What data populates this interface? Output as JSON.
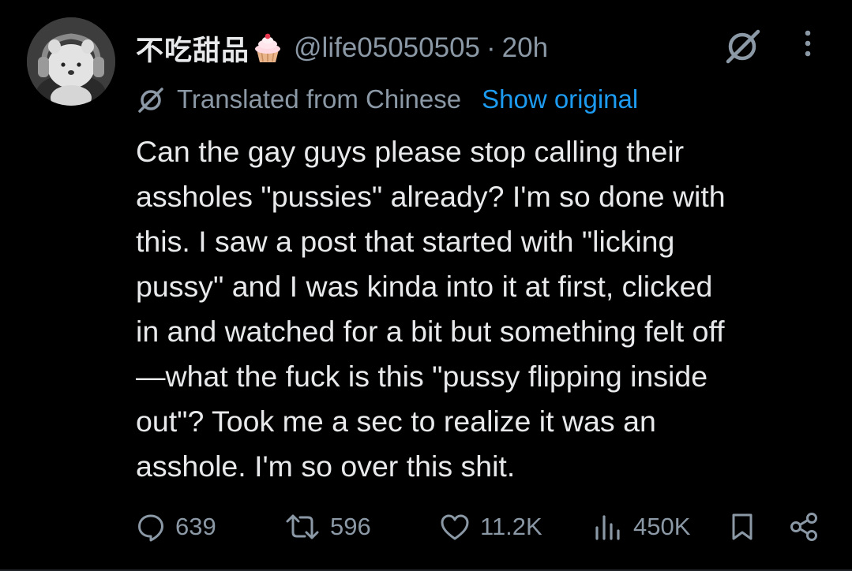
{
  "tweet": {
    "author": {
      "display_name": "不吃甜品",
      "name_emoji": "cupcake-emoji",
      "handle": "@life05050505",
      "separator": "·",
      "time": "20h"
    },
    "translation": {
      "label": "Translated from Chinese",
      "show_original": "Show original"
    },
    "text": "Can the gay guys please stop calling their\nassholes \"pussies\" already? I'm so done with\nthis. I saw a post that started with \"licking\npussy\" and I was kinda into it at first, clicked\nin and watched for a bit but something felt off\n—what the fuck is this \"pussy flipping inside\nout\"? Took me a sec to realize it was an\nasshole. I'm so over this shit.",
    "actions": {
      "replies": "639",
      "reposts": "596",
      "likes": "11.2K",
      "views": "450K"
    }
  },
  "icons": {
    "grok": "grok-icon",
    "more": "more-dots-icon",
    "translate": "translate-icon",
    "reply": "reply-icon",
    "repost": "repost-icon",
    "like": "heart-icon",
    "views": "views-chart-icon",
    "bookmark": "bookmark-icon",
    "share": "share-icon"
  },
  "colors": {
    "background": "#000000",
    "primary_text": "#e7e9ea",
    "secondary_text": "#8b98a5",
    "link": "#1d9bf0"
  }
}
